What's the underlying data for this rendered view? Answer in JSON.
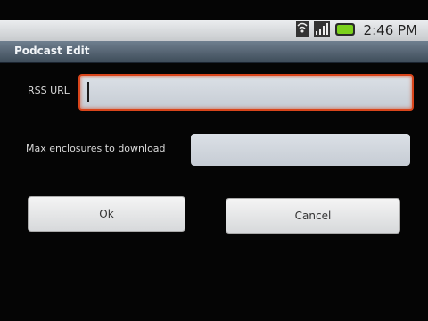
{
  "statusbar": {
    "time": "2:46 PM",
    "icons": [
      "wifi-icon",
      "signal-icon",
      "battery-icon"
    ]
  },
  "titlebar": {
    "title": "Podcast Edit"
  },
  "form": {
    "rss_label": "RSS URL",
    "rss_value": "",
    "max_label": "Max enclosures to download",
    "max_value": ""
  },
  "buttons": {
    "ok": "Ok",
    "cancel": "Cancel"
  },
  "colors": {
    "focus_border": "#d9451b",
    "battery": "#7bd11c"
  }
}
